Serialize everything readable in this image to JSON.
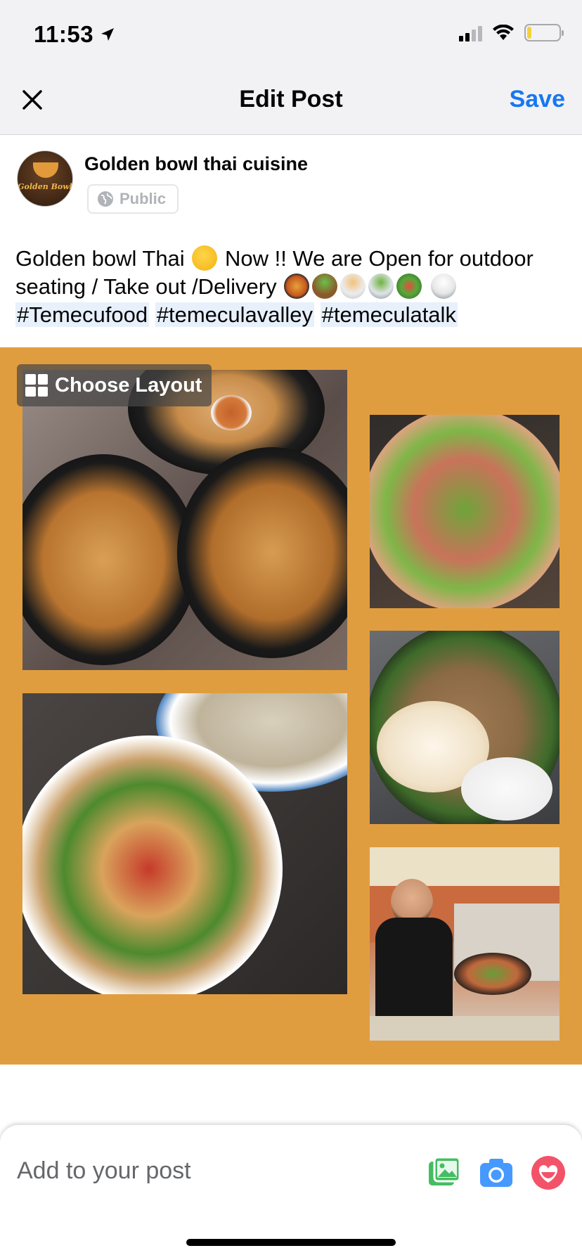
{
  "status_bar": {
    "time": "11:53",
    "icons": [
      "location-arrow-icon",
      "cellular-signal-icon",
      "wifi-icon",
      "battery-icon"
    ],
    "battery_color": "#f3d23a"
  },
  "nav": {
    "close_icon": "close-icon",
    "title": "Edit Post",
    "save_label": "Save",
    "save_color": "#1877f2"
  },
  "author": {
    "name": "Golden bowl thai cuisine",
    "avatar_text": "Golden Bowl",
    "privacy_label": "Public",
    "privacy_icon": "globe-icon"
  },
  "post": {
    "text_part1": "Golden bowl Thai",
    "text_part2": "Now !! We are Open for outdoor seating / Take out /Delivery",
    "emojis": [
      "yum-face-emoji",
      "paella-emoji",
      "salad-bowl-emoji",
      "noodle-bowl-emoji",
      "soup-bowl-emoji",
      "green-salad-emoji",
      "rice-emoji"
    ],
    "hashtags": [
      "#Temecufood",
      "#temeculavalley",
      "#temeculatalk"
    ]
  },
  "collage": {
    "background_color": "#e09d3f",
    "choose_layout_label": "Choose Layout",
    "photos": [
      {
        "name": "pad-thai-satay-photo"
      },
      {
        "name": "seafood-salad-photo"
      },
      {
        "name": "basil-chicken-egg-photo"
      },
      {
        "name": "seafood-soup-photo"
      },
      {
        "name": "staff-serving-photo"
      }
    ]
  },
  "bottom_sheet": {
    "label": "Add to your post",
    "icons": [
      "photo-icon",
      "camera-icon",
      "feeling-icon"
    ]
  }
}
